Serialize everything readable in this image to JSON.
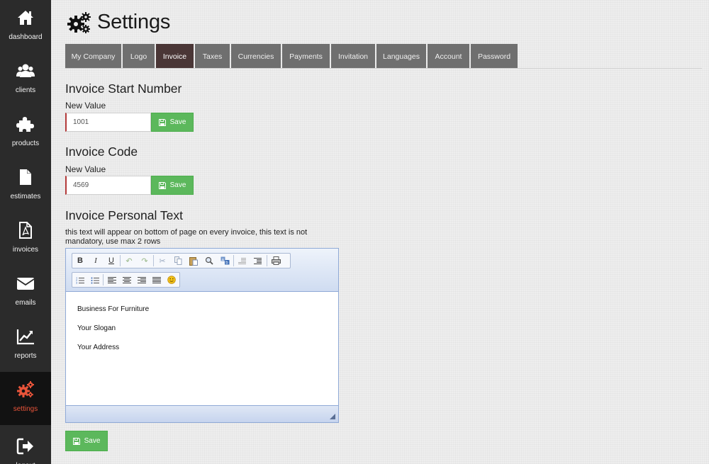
{
  "sidebar": {
    "items": [
      {
        "label": "dashboard",
        "icon": "home-icon"
      },
      {
        "label": "clients",
        "icon": "users-icon"
      },
      {
        "label": "products",
        "icon": "puzzle-icon"
      },
      {
        "label": "estimates",
        "icon": "file-icon"
      },
      {
        "label": "invoices",
        "icon": "pdf-file-icon"
      },
      {
        "label": "emails",
        "icon": "envelope-icon"
      },
      {
        "label": "reports",
        "icon": "line-chart-icon"
      },
      {
        "label": "settings",
        "icon": "cogs-icon"
      },
      {
        "label": "logout",
        "icon": "sign-out-icon"
      }
    ],
    "active": "settings",
    "active_color": "#e8543a"
  },
  "header": {
    "title": "Settings",
    "icon": "cogs-icon"
  },
  "tabs": {
    "items": [
      "My Company",
      "Logo",
      "Invoice",
      "Taxes",
      "Currencies",
      "Payments",
      "Invitation",
      "Languages",
      "Account",
      "Password"
    ],
    "active": "Invoice"
  },
  "invoice_start": {
    "title": "Invoice Start Number",
    "label": "New Value",
    "value": "1001",
    "save_label": "Save"
  },
  "invoice_code": {
    "title": "Invoice Code",
    "label": "New Value",
    "value": "4569",
    "save_label": "Save"
  },
  "personal_text": {
    "title": "Invoice Personal Text",
    "help": "this text will appear on bottom of page on every invoice, this text is not mandatory, use max 2 rows",
    "lines": [
      "Business For Furniture",
      "Your Slogan",
      "Your Address"
    ],
    "save_label": "Save"
  },
  "editor_toolbar": {
    "row1": [
      "bold-icon",
      "italic-icon",
      "underline-icon",
      "undo-icon",
      "redo-icon",
      "cut-icon",
      "copy-icon",
      "paste-icon",
      "find-icon",
      "replace-icon",
      "outdent-icon",
      "indent-icon",
      "print-icon"
    ],
    "row2": [
      "ordered-list-icon",
      "unordered-list-icon",
      "align-left-icon",
      "align-center-icon",
      "align-right-icon",
      "align-justify-icon",
      "emoticon-icon"
    ]
  },
  "colors": {
    "save_green": "#5cb85c",
    "active_tab": "#4a3636",
    "tab": "#6f6f6f",
    "sidebar": "#2b2b2b"
  }
}
